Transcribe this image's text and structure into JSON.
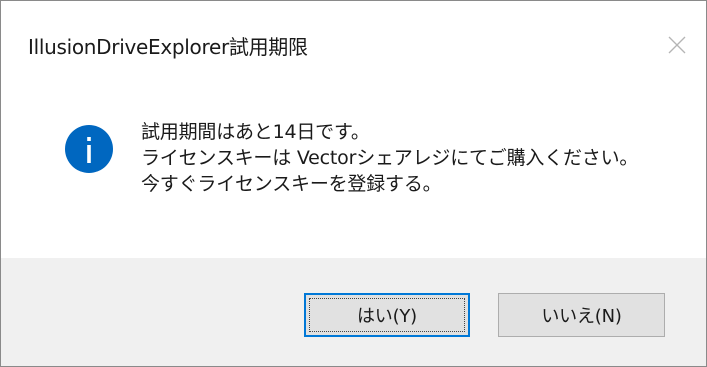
{
  "dialog": {
    "title": "IllusionDriveExplorer試用期限",
    "close_icon": "close-icon",
    "message_icon": "info-icon",
    "accent_color": "#0078d7",
    "message_lines": [
      "試用期間はあと14日です。",
      "ライセンスキーは Vectorシェアレジにてご購入ください。",
      "今すぐライセンスキーを登録する。"
    ],
    "buttons": {
      "yes_label": "はい(Y)",
      "no_label": "いいえ(N)"
    }
  }
}
